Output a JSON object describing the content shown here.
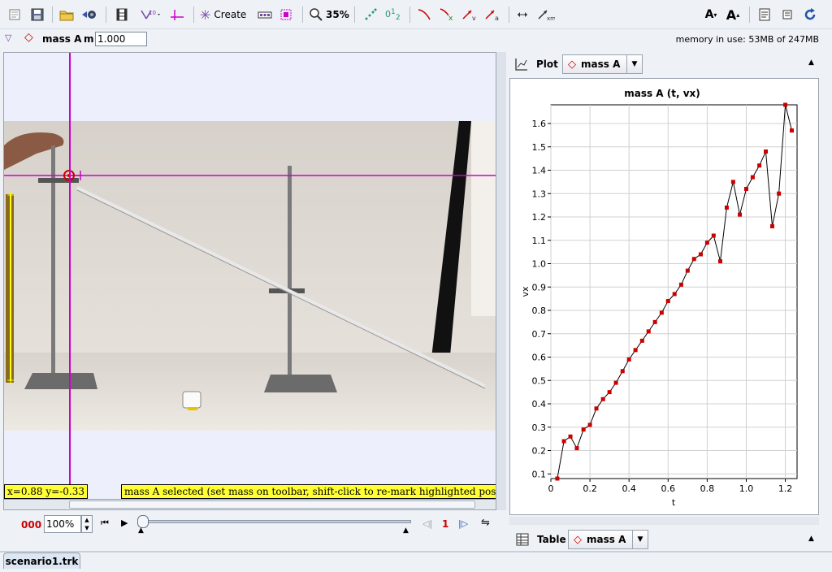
{
  "toolbar": {
    "create_label": "Create",
    "zoom_label": "35%"
  },
  "toolbar2": {
    "track_name": "mass A",
    "mass_label": "m",
    "mass_value": "1.000",
    "memory_text": "memory in use: 53MB of 247MB"
  },
  "video": {
    "coords_text": "x=0.88  y=-0.33",
    "status_text": "mass A selected (set mass on toolbar, shift-click to re-mark highlighted position)"
  },
  "player": {
    "frame_count": "000",
    "zoom_value": "100%",
    "step_size": "1"
  },
  "plot_panel": {
    "tab_label": "Plot",
    "track_name": "mass A"
  },
  "table_panel": {
    "tab_label": "Table",
    "track_name": "mass A"
  },
  "file_tab": {
    "label": "scenario1.trk"
  },
  "colors": {
    "crosshair": "#cc00cc",
    "marker": "#cc0000",
    "calibration": "#ffff00"
  },
  "chart_data": {
    "type": "line",
    "title": "mass A (t, vx)",
    "xlabel": "t",
    "ylabel": "vx",
    "xlim": [
      0,
      1.26
    ],
    "ylim": [
      0.08,
      1.68
    ],
    "xticks": [
      0,
      0.2,
      0.4,
      0.6,
      0.8,
      1.0,
      1.2
    ],
    "xtick_labels": [
      "0",
      "0.2",
      "0.4",
      "0.6",
      "0.8",
      "1.0",
      "1.2"
    ],
    "yticks": [
      0.1,
      0.2,
      0.3,
      0.4,
      0.5,
      0.6,
      0.7,
      0.8,
      0.9,
      1.0,
      1.1,
      1.2,
      1.3,
      1.4,
      1.5,
      1.6
    ],
    "ytick_labels": [
      "0.1",
      "0.2",
      "0.3",
      "0.4",
      "0.5",
      "0.6",
      "0.7",
      "0.8",
      "0.9",
      "1.0",
      "1.1",
      "1.2",
      "1.3",
      "1.4",
      "1.5",
      "1.6"
    ],
    "grid": true,
    "series": [
      {
        "x": [
          0.033,
          0.067,
          0.1,
          0.133,
          0.167,
          0.2,
          0.233,
          0.267,
          0.3,
          0.333,
          0.367,
          0.4,
          0.433,
          0.467,
          0.5,
          0.533,
          0.567,
          0.6,
          0.633,
          0.667,
          0.7,
          0.733,
          0.767,
          0.8,
          0.833,
          0.867,
          0.9,
          0.933,
          0.967,
          1.0,
          1.033,
          1.067,
          1.1,
          1.133,
          1.167,
          1.2,
          1.233
        ],
        "y": [
          0.08,
          0.24,
          0.26,
          0.21,
          0.29,
          0.31,
          0.38,
          0.42,
          0.45,
          0.49,
          0.54,
          0.59,
          0.63,
          0.67,
          0.71,
          0.75,
          0.79,
          0.84,
          0.87,
          0.91,
          0.97,
          1.02,
          1.04,
          1.09,
          1.12,
          1.01,
          1.24,
          1.35,
          1.21,
          1.32,
          1.37,
          1.42,
          1.48,
          1.16,
          1.3,
          1.68,
          1.57
        ]
      }
    ]
  }
}
